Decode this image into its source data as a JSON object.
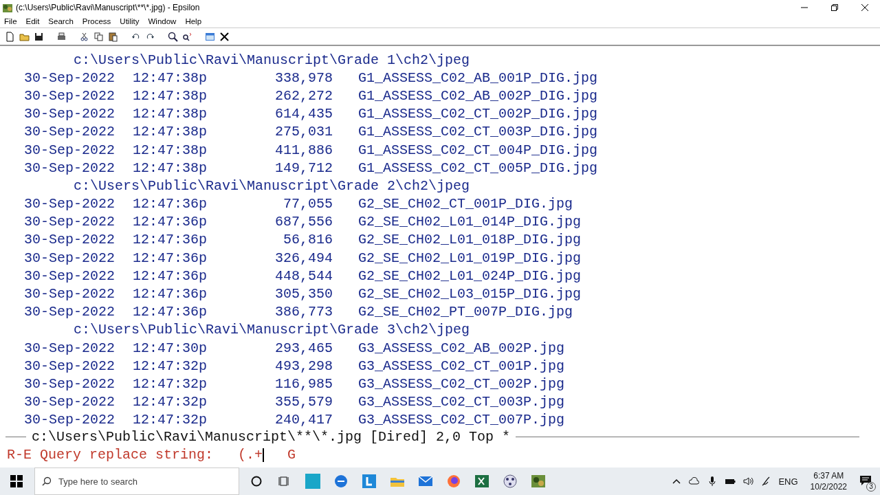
{
  "window": {
    "title": "(c:\\Users\\Public\\Ravi\\Manuscript\\**\\*.jpg) - Epsilon"
  },
  "menu": [
    "File",
    "Edit",
    "Search",
    "Process",
    "Utility",
    "Window",
    "Help"
  ],
  "listing": [
    {
      "directory": "c:\\Users\\Public\\Ravi\\Manuscript\\Grade 1\\ch2\\jpeg",
      "files": [
        {
          "date": "30-Sep-2022",
          "time": "12:47:38p",
          "size": "338,978",
          "name": "G1_ASSESS_C02_AB_001P_DIG.jpg"
        },
        {
          "date": "30-Sep-2022",
          "time": "12:47:38p",
          "size": "262,272",
          "name": "G1_ASSESS_C02_AB_002P_DIG.jpg"
        },
        {
          "date": "30-Sep-2022",
          "time": "12:47:38p",
          "size": "614,435",
          "name": "G1_ASSESS_C02_CT_002P_DIG.jpg"
        },
        {
          "date": "30-Sep-2022",
          "time": "12:47:38p",
          "size": "275,031",
          "name": "G1_ASSESS_C02_CT_003P_DIG.jpg"
        },
        {
          "date": "30-Sep-2022",
          "time": "12:47:38p",
          "size": "411,886",
          "name": "G1_ASSESS_C02_CT_004P_DIG.jpg"
        },
        {
          "date": "30-Sep-2022",
          "time": "12:47:38p",
          "size": "149,712",
          "name": "G1_ASSESS_C02_CT_005P_DIG.jpg"
        }
      ]
    },
    {
      "directory": "c:\\Users\\Public\\Ravi\\Manuscript\\Grade 2\\ch2\\jpeg",
      "files": [
        {
          "date": "30-Sep-2022",
          "time": "12:47:36p",
          "size": "77,055",
          "name": "G2_SE_CH02_CT_001P_DIG.jpg"
        },
        {
          "date": "30-Sep-2022",
          "time": "12:47:36p",
          "size": "687,556",
          "name": "G2_SE_CH02_L01_014P_DIG.jpg"
        },
        {
          "date": "30-Sep-2022",
          "time": "12:47:36p",
          "size": "56,816",
          "name": "G2_SE_CH02_L01_018P_DIG.jpg"
        },
        {
          "date": "30-Sep-2022",
          "time": "12:47:36p",
          "size": "326,494",
          "name": "G2_SE_CH02_L01_019P_DIG.jpg"
        },
        {
          "date": "30-Sep-2022",
          "time": "12:47:36p",
          "size": "448,544",
          "name": "G2_SE_CH02_L01_024P_DIG.jpg"
        },
        {
          "date": "30-Sep-2022",
          "time": "12:47:36p",
          "size": "305,350",
          "name": "G2_SE_CH02_L03_015P_DIG.jpg"
        },
        {
          "date": "30-Sep-2022",
          "time": "12:47:36p",
          "size": "386,773",
          "name": "G2_SE_CH02_PT_007P_DIG.jpg"
        }
      ]
    },
    {
      "directory": "c:\\Users\\Public\\Ravi\\Manuscript\\Grade 3\\ch2\\jpeg",
      "files": [
        {
          "date": "30-Sep-2022",
          "time": "12:47:30p",
          "size": "293,465",
          "name": "G3_ASSESS_C02_AB_002P.jpg"
        },
        {
          "date": "30-Sep-2022",
          "time": "12:47:32p",
          "size": "493,298",
          "name": "G3_ASSESS_C02_CT_001P.jpg"
        },
        {
          "date": "30-Sep-2022",
          "time": "12:47:32p",
          "size": "116,985",
          "name": "G3_ASSESS_C02_CT_002P.jpg"
        },
        {
          "date": "30-Sep-2022",
          "time": "12:47:32p",
          "size": "355,579",
          "name": "G3_ASSESS_C02_CT_003P.jpg"
        },
        {
          "date": "30-Sep-2022",
          "time": "12:47:32p",
          "size": "240,417",
          "name": "G3_ASSESS_C02_CT_007P.jpg"
        }
      ]
    }
  ],
  "mode_line": "c:\\Users\\Public\\Ravi\\Manuscript\\**\\*.jpg [Dired] 2,0 Top *",
  "minibuffer": {
    "prompt": "R-E Query replace string:",
    "input": "(.+",
    "after_cursor": "G"
  },
  "taskbar": {
    "search_placeholder": "Type here to search",
    "language": "ENG",
    "time": "6:37 AM",
    "date": "10/2/2022",
    "notifications": "3"
  }
}
